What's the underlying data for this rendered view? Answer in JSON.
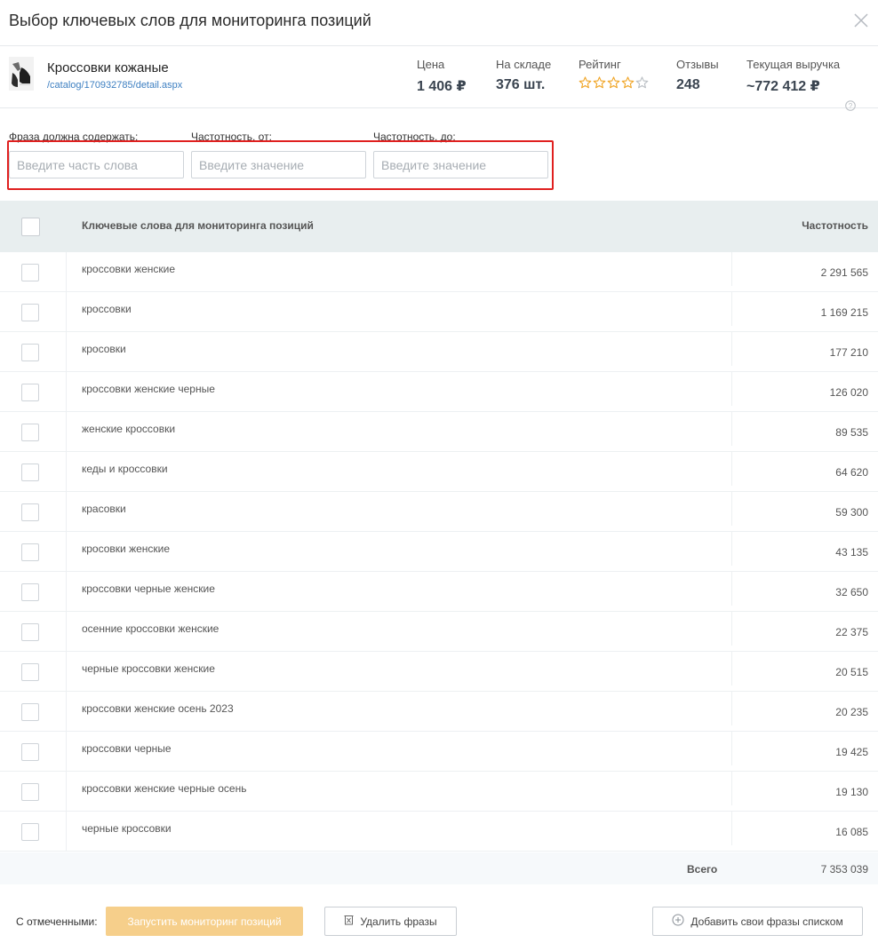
{
  "modal": {
    "title": "Выбор ключевых слов для мониторинга позиций"
  },
  "product": {
    "name": "Кроссовки кожаные",
    "link": "/catalog/170932785/detail.aspx",
    "stats": {
      "price": {
        "label": "Цена",
        "value": "1 406 ₽"
      },
      "stock": {
        "label": "На складе",
        "value": "376 шт."
      },
      "rating": {
        "label": "Рейтинг",
        "stars_filled": 4,
        "stars_total": 5
      },
      "reviews": {
        "label": "Отзывы",
        "value": "248"
      },
      "revenue": {
        "label": "Текущая выручка",
        "value": "~772 412 ₽"
      }
    }
  },
  "filters": {
    "phrase": {
      "label": "Фраза должна содержать:",
      "placeholder": "Введите часть слова",
      "value": ""
    },
    "freq_from": {
      "label": "Частотность, от:",
      "placeholder": "Введите значение",
      "value": ""
    },
    "freq_to": {
      "label": "Частотность, до:",
      "placeholder": "Введите значение",
      "value": ""
    }
  },
  "table": {
    "headers": {
      "keywords": "Ключевые слова для мониторинга позиций",
      "frequency": "Частотность"
    },
    "rows": [
      {
        "keyword": "кроссовки женские",
        "frequency": "2 291 565"
      },
      {
        "keyword": "кроссовки",
        "frequency": "1 169 215"
      },
      {
        "keyword": "кросовки",
        "frequency": "177 210"
      },
      {
        "keyword": "кроссовки женские черные",
        "frequency": "126 020"
      },
      {
        "keyword": "женские кроссовки",
        "frequency": "89 535"
      },
      {
        "keyword": "кеды и кроссовки",
        "frequency": "64 620"
      },
      {
        "keyword": "красовки",
        "frequency": "59 300"
      },
      {
        "keyword": "кросовки женские",
        "frequency": "43 135"
      },
      {
        "keyword": "кроссовки черные женские",
        "frequency": "32 650"
      },
      {
        "keyword": "осенние кроссовки женские",
        "frequency": "22 375"
      },
      {
        "keyword": "черные кроссовки женские",
        "frequency": "20 515"
      },
      {
        "keyword": "кроссовки женские осень 2023",
        "frequency": "20 235"
      },
      {
        "keyword": "кроссовки черные",
        "frequency": "19 425"
      },
      {
        "keyword": "кроссовки женские черные осень",
        "frequency": "19 130"
      },
      {
        "keyword": "черные кроссовки",
        "frequency": "16 085"
      }
    ],
    "total": {
      "label": "Всего",
      "value": "7 353 039"
    }
  },
  "footer": {
    "label": "С отмеченными:",
    "start_button": "Запустить мониторинг позиций",
    "delete_button": "Удалить фразы",
    "add_button": "Добавить свои фразы списком"
  },
  "colors": {
    "accent": "#f6cf8b",
    "highlight": "#e0201f",
    "link": "#3d7fc1",
    "star": "#f0a321",
    "header_bg": "#e8eeef"
  },
  "icons": {
    "close": "close-icon",
    "help": "help-icon",
    "star": "star-icon",
    "trash": "trash-icon",
    "add": "plus-circle-icon"
  }
}
